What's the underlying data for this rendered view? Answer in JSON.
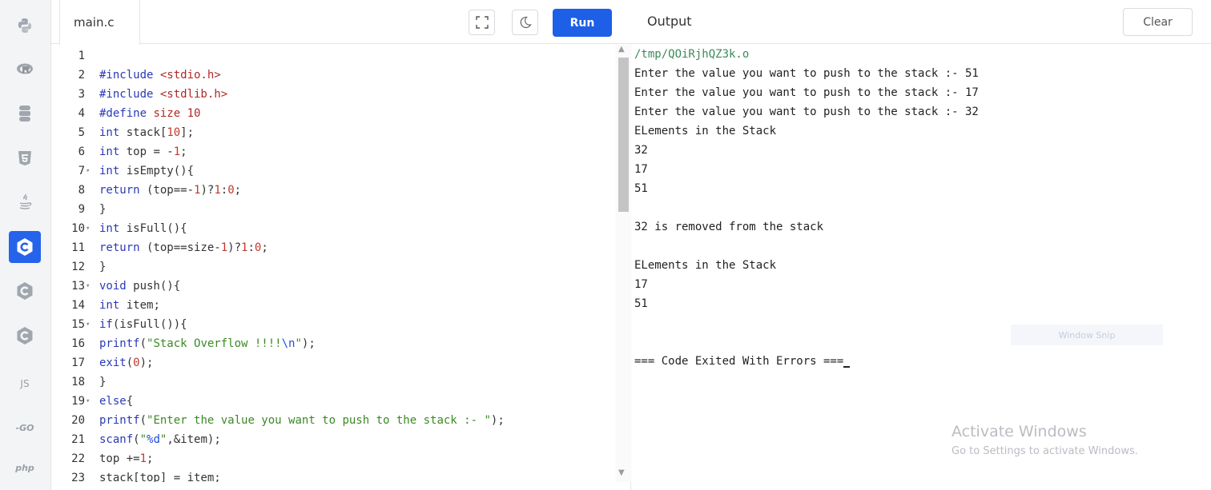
{
  "sidebar": {
    "languages": [
      {
        "name": "python",
        "label": ""
      },
      {
        "name": "r",
        "label": ""
      },
      {
        "name": "sql",
        "label": ""
      },
      {
        "name": "html5",
        "label": ""
      },
      {
        "name": "java",
        "label": ""
      },
      {
        "name": "c",
        "label": ""
      },
      {
        "name": "cpp",
        "label": ""
      },
      {
        "name": "csharp",
        "label": ""
      },
      {
        "name": "javascript",
        "label": "JS"
      },
      {
        "name": "go",
        "label": "-GO"
      },
      {
        "name": "php",
        "label": "php"
      }
    ],
    "active": "c",
    "accent": "#2563eb"
  },
  "editor": {
    "tab_label": "main.c",
    "run_label": "Run",
    "lines": [
      {
        "n": "1",
        "fold": false,
        "code": ""
      },
      {
        "n": "2",
        "fold": false,
        "code": "#include <stdio.h>"
      },
      {
        "n": "3",
        "fold": false,
        "code": "#include <stdlib.h>"
      },
      {
        "n": "4",
        "fold": false,
        "code": "#define size 10"
      },
      {
        "n": "5",
        "fold": false,
        "code": "int stack[10];"
      },
      {
        "n": "6",
        "fold": false,
        "code": "int top = -1;"
      },
      {
        "n": "7",
        "fold": true,
        "code": "int isEmpty(){"
      },
      {
        "n": "8",
        "fold": false,
        "code": "return (top==-1)?1:0;"
      },
      {
        "n": "9",
        "fold": false,
        "code": "}"
      },
      {
        "n": "10",
        "fold": true,
        "code": "int isFull(){"
      },
      {
        "n": "11",
        "fold": false,
        "code": "return (top==size-1)?1:0;"
      },
      {
        "n": "12",
        "fold": false,
        "code": "}"
      },
      {
        "n": "13",
        "fold": true,
        "code": "void push(){"
      },
      {
        "n": "14",
        "fold": false,
        "code": "int item;"
      },
      {
        "n": "15",
        "fold": true,
        "code": "if(isFull()){"
      },
      {
        "n": "16",
        "fold": false,
        "code": "printf(\"Stack Overflow !!!!\\n\");"
      },
      {
        "n": "17",
        "fold": false,
        "code": "exit(0);"
      },
      {
        "n": "18",
        "fold": false,
        "code": "}"
      },
      {
        "n": "19",
        "fold": true,
        "code": "else{"
      },
      {
        "n": "20",
        "fold": false,
        "code": "printf(\"Enter the value you want to push to the stack :- \");"
      },
      {
        "n": "21",
        "fold": false,
        "code": "scanf(\"%d\",&item);"
      },
      {
        "n": "22",
        "fold": false,
        "code": "top +=1;"
      },
      {
        "n": "23",
        "fold": false,
        "code": "stack[top] = item;"
      }
    ]
  },
  "output": {
    "title": "Output",
    "clear_label": "Clear",
    "lines": [
      "/tmp/QOiRjhQZ3k.o",
      "Enter the value you want to push to the stack :- 51",
      "Enter the value you want to push to the stack :- 17",
      "Enter the value you want to push to the stack :- 32",
      "ELements in the Stack",
      "32",
      "17",
      "51",
      "",
      "32 is removed from the stack",
      "",
      "ELements in the Stack",
      "17",
      "51",
      "",
      "",
      "=== Code Exited With Errors ==="
    ],
    "snip_label": "Window Snip"
  },
  "watermark": {
    "title": "Activate Windows",
    "subtitle": "Go to Settings to activate Windows."
  }
}
